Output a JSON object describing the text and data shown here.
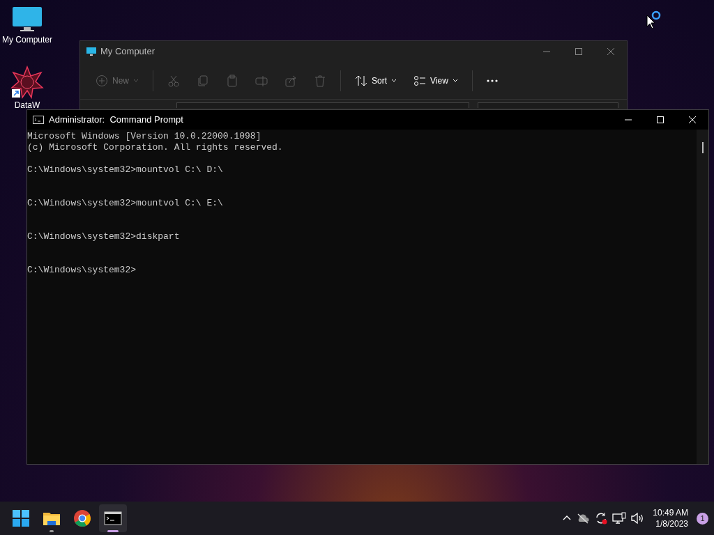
{
  "desktop_icons": [
    {
      "kind": "computer",
      "label": "My Computer"
    },
    {
      "kind": "app",
      "label": "DataW"
    }
  ],
  "explorer": {
    "title": "My Computer",
    "toolbar": [
      {
        "kind": "new",
        "label": "New",
        "disabled": true
      },
      {
        "kind": "cut",
        "disabled": true
      },
      {
        "kind": "copy",
        "disabled": true
      },
      {
        "kind": "paste",
        "disabled": true
      },
      {
        "kind": "rename",
        "disabled": true
      },
      {
        "kind": "share",
        "disabled": true
      },
      {
        "kind": "delete",
        "disabled": true
      },
      {
        "kind": "sort",
        "label": "Sort",
        "disabled": false
      },
      {
        "kind": "view",
        "label": "View",
        "disabled": false
      },
      {
        "kind": "more",
        "disabled": false
      }
    ]
  },
  "console": {
    "title": "Administrator:  Command Prompt",
    "header_lines": [
      "Microsoft Windows [Version 10.0.22000.1098]",
      "(c) Microsoft Corporation. All rights reserved."
    ],
    "prompt_lines": [
      "C:\\Windows\\system32>mountvol C:\\ D:\\",
      "C:\\Windows\\system32>mountvol C:\\ E:\\",
      "C:\\Windows\\system32>diskpart",
      "C:\\Windows\\system32>"
    ]
  },
  "taskbar": {
    "apps": [
      {
        "kind": "start",
        "running": false,
        "active": false
      },
      {
        "kind": "folder",
        "running": true,
        "active": false
      },
      {
        "kind": "chrome",
        "running": false,
        "active": false
      },
      {
        "kind": "terminal",
        "running": true,
        "active": true
      }
    ],
    "time": "10:49 AM",
    "date": "1/8/2023",
    "notifications": "1"
  }
}
